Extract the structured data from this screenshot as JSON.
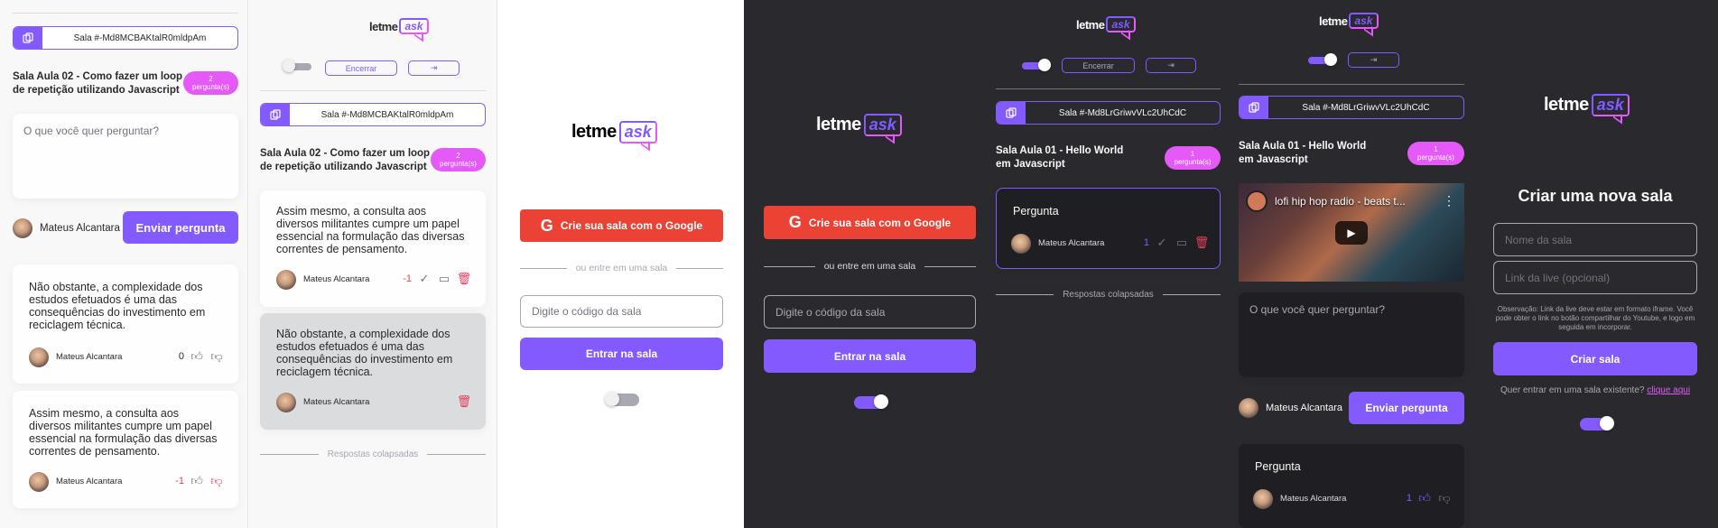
{
  "colors": {
    "primary": "#835afd",
    "pink": "#e559f9",
    "danger": "#e73f5d",
    "google": "#ea4335",
    "dark_bg": "#29292e",
    "light_bg": "#f8f8f8"
  },
  "logo": {
    "letme": "letme",
    "ask": "ask"
  },
  "room_light": {
    "code_label": "Sala #-Md8MCBAKtalR0mldpAm",
    "title": "Sala Aula 02 - Como fazer um loop de repetição utilizando Javascript",
    "count_num": "2",
    "count_label": "pergunta(s)"
  },
  "room_dark": {
    "code_label": "Sala #-Md8LrGriwvVLc2UhCdC",
    "title": "Sala Aula 01 - Hello World em Javascript",
    "count_num": "1",
    "count_label": "pergunta(s)"
  },
  "admin": {
    "close_label": "Encerrar",
    "logout_icon": "logout-icon"
  },
  "ask_form": {
    "placeholder": "O que você quer perguntar?",
    "user": "Mateus Alcantara",
    "submit": "Enviar pergunta"
  },
  "questions_light": [
    {
      "text": "Não obstante, a complexidade dos estudos efetuados é uma das consequências do investimento em reciclagem técnica.",
      "author": "Mateus Alcantara",
      "likes": "0"
    },
    {
      "text": "Assim mesmo, a consulta aos diversos militantes cumpre um papel essencial na formulação das diversas correntes de pensamento.",
      "author": "Mateus Alcantara",
      "likes": "-1"
    }
  ],
  "questions_admin": [
    {
      "text": "Assim mesmo, a consulta aos diversos militantes cumpre um papel essencial na formulação das diversas correntes de pensamento.",
      "author": "Mateus Alcantara",
      "likes": "-1"
    },
    {
      "text": "Não obstante, a complexidade dos estudos efetuados é uma das consequências do investimento em reciclagem técnica.",
      "author": "Mateus Alcantara"
    }
  ],
  "collapsed_label": "Respostas colapsadas",
  "home": {
    "google": "Crie sua sala com o Google",
    "divider": "ou entre em uma sala",
    "code_placeholder": "Digite o código da sala",
    "enter": "Entrar na sala"
  },
  "dark_admin_q": {
    "text": "Pergunta",
    "author": "Mateus Alcantara",
    "likes": "1"
  },
  "video": {
    "title": "lofi hip hop radio - beats t..."
  },
  "dark_room_q": {
    "text": "Pergunta",
    "author": "Mateus Alcantara",
    "likes": "1"
  },
  "new_room": {
    "heading": "Criar uma nova sala",
    "name_placeholder": "Nome da sala",
    "live_placeholder": "Link da live (opcional)",
    "note": "Observação: Link da live deve estar em formato iframe. Você pode obter o link no botão compartilhar do Youtube, e logo em seguida em incorporar.",
    "create": "Criar sala",
    "existing": "Quer entrar em uma sala existente?",
    "click_here": "clique aqui"
  }
}
